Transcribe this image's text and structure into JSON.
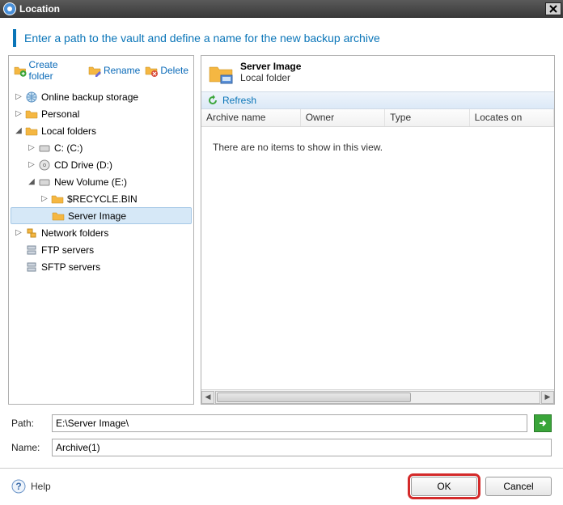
{
  "window": {
    "title": "Location"
  },
  "header": {
    "instruction": "Enter a path to the vault and define a name for the new backup archive"
  },
  "toolbar": {
    "create_label": "Create folder",
    "rename_label": "Rename",
    "delete_label": "Delete"
  },
  "tree": {
    "online": "Online backup storage",
    "personal": "Personal",
    "local": "Local folders",
    "c": "C: (C:)",
    "cd": "CD Drive (D:)",
    "e": "New Volume (E:)",
    "recycle": "$RECYCLE.BIN",
    "server_image": "Server Image",
    "network": "Network folders",
    "ftp": "FTP servers",
    "sftp": "SFTP servers"
  },
  "detail": {
    "name": "Server Image",
    "subtitle": "Local folder",
    "refresh_label": "Refresh",
    "columns": {
      "archive": "Archive name",
      "owner": "Owner",
      "type": "Type",
      "locates": "Locates on"
    },
    "empty_message": "There are no items to show in this view."
  },
  "form": {
    "path_label": "Path:",
    "path_value": "E:\\Server Image\\",
    "name_label": "Name:",
    "name_value": "Archive(1)"
  },
  "bottom": {
    "help_label": "Help",
    "ok_label": "OK",
    "cancel_label": "Cancel"
  }
}
